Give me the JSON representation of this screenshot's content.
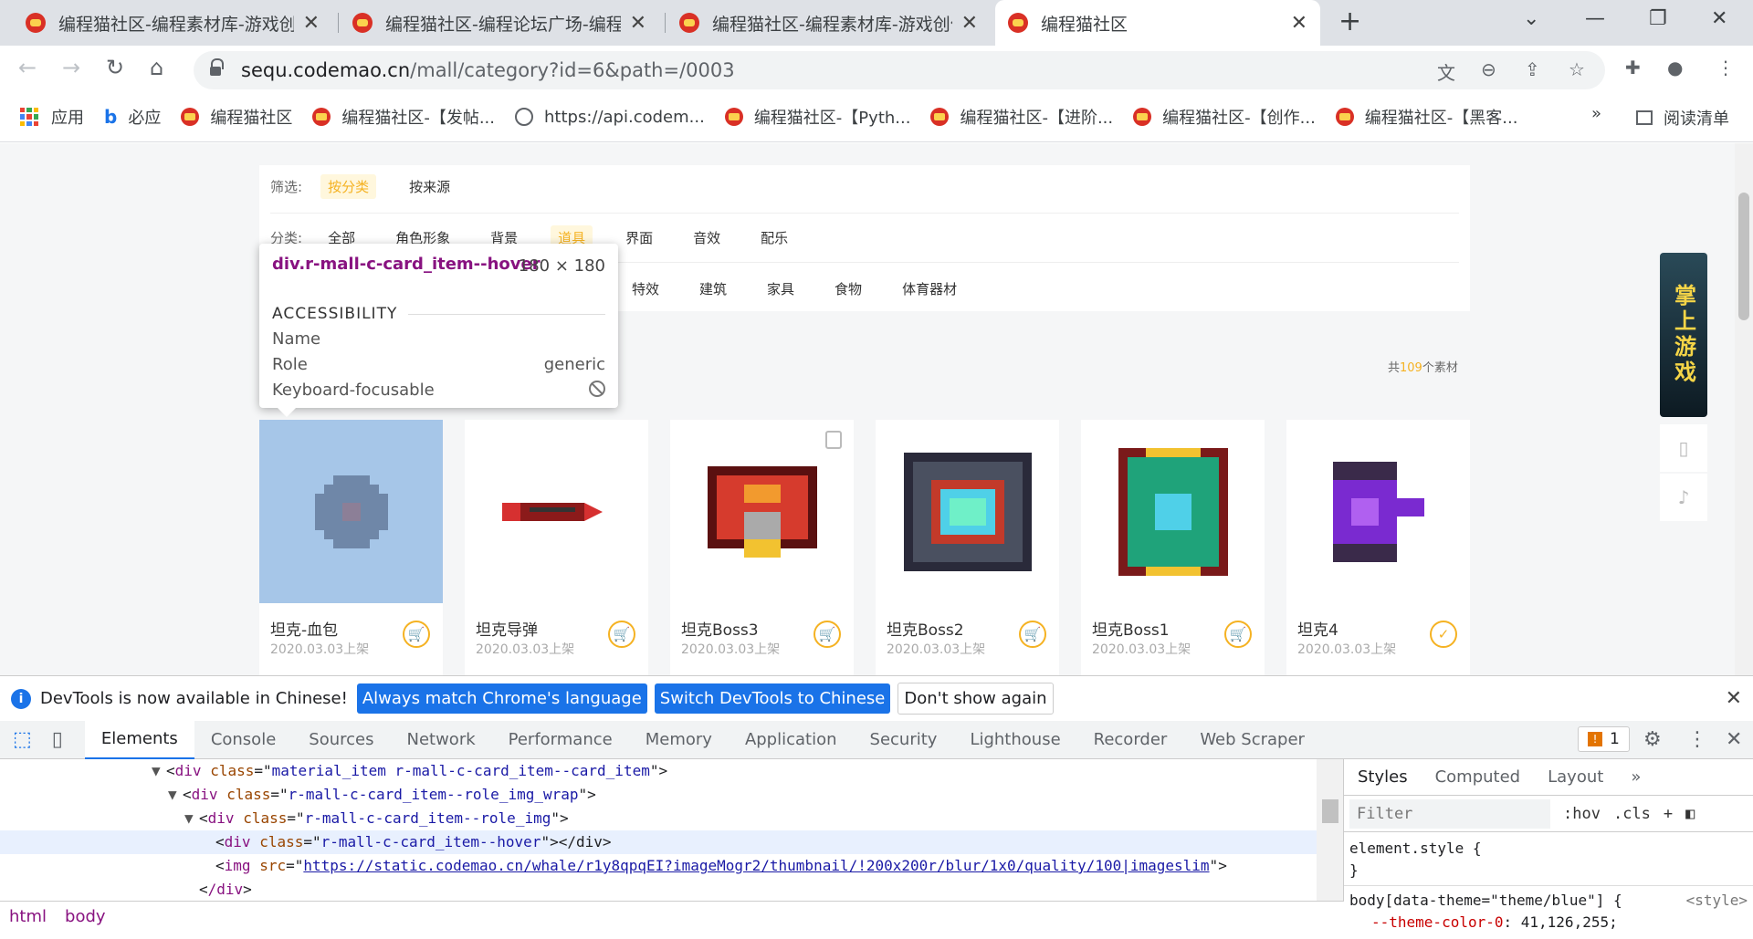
{
  "browser": {
    "tabs": [
      {
        "title": "编程猫社区-编程素材库-游戏创作"
      },
      {
        "title": "编程猫社区-编程论坛广场-编程学"
      },
      {
        "title": "编程猫社区-编程素材库-游戏创作"
      },
      {
        "title": "编程猫社区"
      }
    ],
    "url_host": "sequ.codemao.cn",
    "url_path": "/mall/category?id=6&path=/0003",
    "bookmarks": [
      {
        "label": "应用"
      },
      {
        "label": "必应"
      },
      {
        "label": "编程猫社区"
      },
      {
        "label": "编程猫社区-【发帖..."
      },
      {
        "label": "https://api.codem..."
      },
      {
        "label": "编程猫社区-【Pyth..."
      },
      {
        "label": "编程猫社区-【进阶..."
      },
      {
        "label": "编程猫社区-【创作..."
      },
      {
        "label": "编程猫社区-【黑客..."
      }
    ],
    "bookmarks_more": "»",
    "reading_list": "阅读清单"
  },
  "filters": {
    "row1_label": "筛选:",
    "row1": [
      "按分类",
      "按来源"
    ],
    "row2_label": "分类:",
    "row2": [
      "全部",
      "角色形象",
      "背景",
      "道具",
      "界面",
      "音效",
      "配乐"
    ],
    "row3": [
      "特效",
      "建筑",
      "家具",
      "食物",
      "体育器材"
    ]
  },
  "count": {
    "prefix": "共",
    "value": "109",
    "suffix": "个素材"
  },
  "cards": [
    {
      "name": "坦克-血包",
      "date": "2020.03.03上架"
    },
    {
      "name": "坦克导弹",
      "date": "2020.03.03上架"
    },
    {
      "name": "坦克Boss3",
      "date": "2020.03.03上架"
    },
    {
      "name": "坦克Boss2",
      "date": "2020.03.03上架"
    },
    {
      "name": "坦克Boss1",
      "date": "2020.03.03上架"
    },
    {
      "name": "坦克4",
      "date": "2020.03.03上架"
    }
  ],
  "banner_text": "掌上游戏",
  "tooltip": {
    "selector": "div.r-mall-c-card_item--hover",
    "size": "180 × 180",
    "section": "ACCESSIBILITY",
    "name_label": "Name",
    "role_label": "Role",
    "role_value": "generic",
    "focus_label": "Keyboard-focusable"
  },
  "infobar": {
    "message": "DevTools is now available in Chinese!",
    "btn_match": "Always match Chrome's language",
    "btn_switch": "Switch DevTools to Chinese",
    "btn_dont": "Don't show again"
  },
  "devtools": {
    "tabs": [
      "Elements",
      "Console",
      "Sources",
      "Network",
      "Performance",
      "Memory",
      "Application",
      "Security",
      "Lighthouse",
      "Recorder",
      "Web Scraper"
    ],
    "warnings": "1",
    "dom": [
      {
        "indent": 0,
        "arrow": "▼",
        "tag": "div",
        "attr": "class",
        "val": "material_item r-mall-c-card_item--card_item",
        "end": ">"
      },
      {
        "indent": 1,
        "arrow": "▼",
        "tag": "div",
        "attr": "class",
        "val": "r-mall-c-card_item--role_img_wrap",
        "end": ">"
      },
      {
        "indent": 2,
        "arrow": "▼",
        "tag": "div",
        "attr": "class",
        "val": "r-mall-c-card_item--role_img",
        "end": ">"
      },
      {
        "indent": 3,
        "arrow": "",
        "tag": "div",
        "attr": "class",
        "val": "r-mall-c-card_item--hover",
        "end": "></div>"
      },
      {
        "indent": 3,
        "arrow": "",
        "tag": "img",
        "attr": "src",
        "val": "https://static.codemao.cn/whale/r1y8qpqEI?imageMogr2/thumbnail/!200x200r/blur/1x0/quality/100|imageslim",
        "end": ">"
      },
      {
        "indent": 2,
        "arrow": "",
        "tag": "/div",
        "attr": "",
        "val": "",
        "end": ">"
      }
    ],
    "styles_tabs": [
      "Styles",
      "Computed",
      "Layout",
      "»"
    ],
    "filter_placeholder": "Filter",
    "hov": ":hov",
    "cls": ".cls",
    "rule1": "element.style {",
    "rule1_close": "}",
    "rule2_selector": "body[data-theme=\"theme/blue\"] {",
    "rule2_source": "<style>",
    "rule2_prop": "--theme-color-0",
    "rule2_value": "41,126,255;",
    "breadcrumb": [
      "html",
      "body"
    ]
  }
}
